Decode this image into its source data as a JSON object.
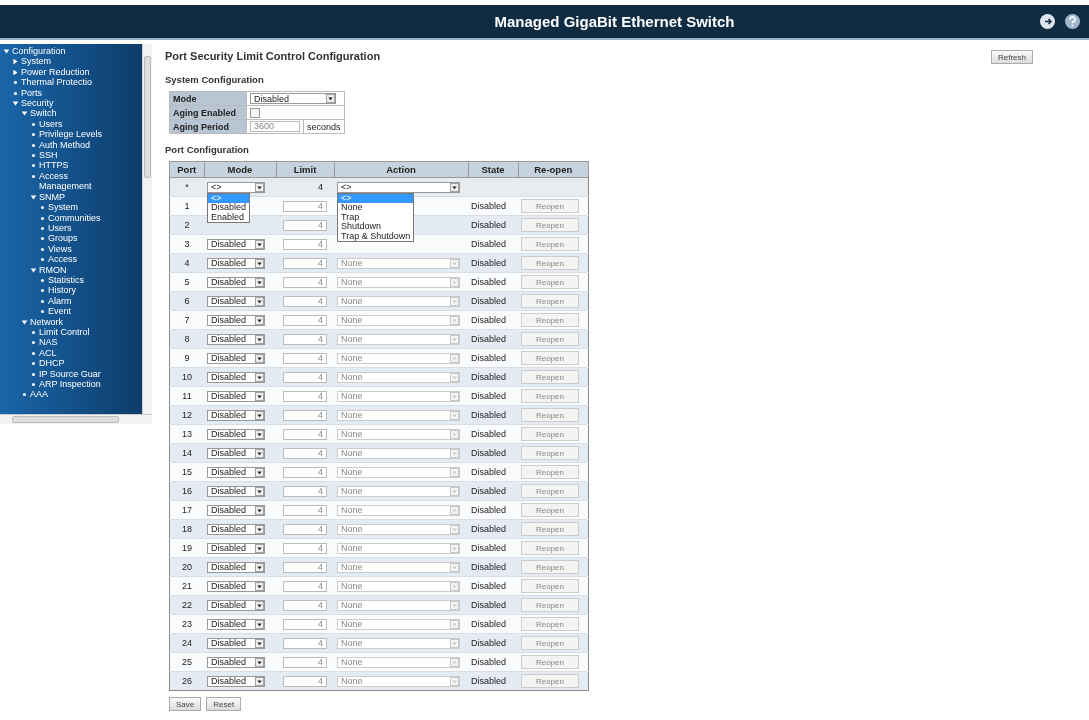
{
  "header": {
    "title": "Managed GigaBit Ethernet Switch"
  },
  "sidebar": {
    "items": [
      {
        "label": "Configuration",
        "expanded": true,
        "children": [
          {
            "label": "System",
            "expanded": false
          },
          {
            "label": "Power Reduction",
            "expanded": false
          },
          {
            "label": "Thermal Protectio"
          },
          {
            "label": "Ports"
          },
          {
            "label": "Security",
            "expanded": true,
            "children": [
              {
                "label": "Switch",
                "expanded": true,
                "children": [
                  {
                    "label": "Users"
                  },
                  {
                    "label": "Privilege Levels"
                  },
                  {
                    "label": "Auth Method"
                  },
                  {
                    "label": "SSH"
                  },
                  {
                    "label": "HTTPS"
                  },
                  {
                    "label": "Access Management"
                  },
                  {
                    "label": "SNMP",
                    "expanded": true,
                    "children": [
                      {
                        "label": "System"
                      },
                      {
                        "label": "Communities"
                      },
                      {
                        "label": "Users"
                      },
                      {
                        "label": "Groups"
                      },
                      {
                        "label": "Views"
                      },
                      {
                        "label": "Access"
                      }
                    ]
                  },
                  {
                    "label": "RMON",
                    "expanded": true,
                    "children": [
                      {
                        "label": "Statistics"
                      },
                      {
                        "label": "History"
                      },
                      {
                        "label": "Alarm"
                      },
                      {
                        "label": "Event"
                      }
                    ]
                  }
                ]
              },
              {
                "label": "Network",
                "expanded": true,
                "children": [
                  {
                    "label": "Limit Control"
                  },
                  {
                    "label": "NAS"
                  },
                  {
                    "label": "ACL"
                  },
                  {
                    "label": "DHCP"
                  },
                  {
                    "label": "IP Source Guar"
                  },
                  {
                    "label": "ARP Inspection"
                  }
                ]
              },
              {
                "label": "AAA"
              }
            ]
          }
        ]
      }
    ]
  },
  "page": {
    "title": "Port Security Limit Control Configuration",
    "refresh_button": "Refresh",
    "system_config": {
      "heading": "System Configuration",
      "mode": {
        "label": "Mode",
        "value": "Disabled"
      },
      "aging_enabled": {
        "label": "Aging Enabled",
        "checked": false
      },
      "aging_period": {
        "label": "Aging Period",
        "value": "3600",
        "unit": "seconds"
      }
    },
    "port_config": {
      "heading": "Port Configuration",
      "columns": [
        "Port",
        "Mode",
        "Limit",
        "Action",
        "State",
        "Re-open"
      ],
      "all_row": {
        "port": "*",
        "mode": "<>",
        "limit": "4",
        "action": "<>"
      },
      "mode_dropdown": {
        "options": [
          {
            "label": "<>",
            "selected": true
          },
          {
            "label": "Disabled",
            "selected": false
          },
          {
            "label": "Enabled",
            "selected": false
          }
        ]
      },
      "action_dropdown": {
        "options": [
          {
            "label": "<>",
            "selected": true
          },
          {
            "label": "None",
            "selected": false
          },
          {
            "label": "Trap",
            "selected": false
          },
          {
            "label": "Shutdown",
            "selected": false
          },
          {
            "label": "Trap & Shutdown",
            "selected": false
          }
        ]
      },
      "rows": [
        {
          "port": "1",
          "limit": "4",
          "state": "Disabled",
          "reopen": "Reopen"
        },
        {
          "port": "2",
          "limit": "4",
          "state": "Disabled",
          "reopen": "Reopen"
        },
        {
          "port": "3",
          "mode": "Disabled",
          "limit": "4",
          "state": "Disabled",
          "reopen": "Reopen"
        },
        {
          "port": "4",
          "mode": "Disabled",
          "limit": "4",
          "action": "None",
          "state": "Disabled",
          "reopen": "Reopen"
        },
        {
          "port": "5",
          "mode": "Disabled",
          "limit": "4",
          "action": "None",
          "state": "Disabled",
          "reopen": "Reopen"
        },
        {
          "port": "6",
          "mode": "Disabled",
          "limit": "4",
          "action": "None",
          "state": "Disabled",
          "reopen": "Reopen"
        },
        {
          "port": "7",
          "mode": "Disabled",
          "limit": "4",
          "action": "None",
          "state": "Disabled",
          "reopen": "Reopen"
        },
        {
          "port": "8",
          "mode": "Disabled",
          "limit": "4",
          "action": "None",
          "state": "Disabled",
          "reopen": "Reopen"
        },
        {
          "port": "9",
          "mode": "Disabled",
          "limit": "4",
          "action": "None",
          "state": "Disabled",
          "reopen": "Reopen"
        },
        {
          "port": "10",
          "mode": "Disabled",
          "limit": "4",
          "action": "None",
          "state": "Disabled",
          "reopen": "Reopen"
        },
        {
          "port": "11",
          "mode": "Disabled",
          "limit": "4",
          "action": "None",
          "state": "Disabled",
          "reopen": "Reopen"
        },
        {
          "port": "12",
          "mode": "Disabled",
          "limit": "4",
          "action": "None",
          "state": "Disabled",
          "reopen": "Reopen"
        },
        {
          "port": "13",
          "mode": "Disabled",
          "limit": "4",
          "action": "None",
          "state": "Disabled",
          "reopen": "Reopen"
        },
        {
          "port": "14",
          "mode": "Disabled",
          "limit": "4",
          "action": "None",
          "state": "Disabled",
          "reopen": "Reopen"
        },
        {
          "port": "15",
          "mode": "Disabled",
          "limit": "4",
          "action": "None",
          "state": "Disabled",
          "reopen": "Reopen"
        },
        {
          "port": "16",
          "mode": "Disabled",
          "limit": "4",
          "action": "None",
          "state": "Disabled",
          "reopen": "Reopen"
        },
        {
          "port": "17",
          "mode": "Disabled",
          "limit": "4",
          "action": "None",
          "state": "Disabled",
          "reopen": "Reopen"
        },
        {
          "port": "18",
          "mode": "Disabled",
          "limit": "4",
          "action": "None",
          "state": "Disabled",
          "reopen": "Reopen"
        },
        {
          "port": "19",
          "mode": "Disabled",
          "limit": "4",
          "action": "None",
          "state": "Disabled",
          "reopen": "Reopen"
        },
        {
          "port": "20",
          "mode": "Disabled",
          "limit": "4",
          "action": "None",
          "state": "Disabled",
          "reopen": "Reopen"
        },
        {
          "port": "21",
          "mode": "Disabled",
          "limit": "4",
          "action": "None",
          "state": "Disabled",
          "reopen": "Reopen"
        },
        {
          "port": "22",
          "mode": "Disabled",
          "limit": "4",
          "action": "None",
          "state": "Disabled",
          "reopen": "Reopen"
        },
        {
          "port": "23",
          "mode": "Disabled",
          "limit": "4",
          "action": "None",
          "state": "Disabled",
          "reopen": "Reopen"
        },
        {
          "port": "24",
          "mode": "Disabled",
          "limit": "4",
          "action": "None",
          "state": "Disabled",
          "reopen": "Reopen"
        },
        {
          "port": "25",
          "mode": "Disabled",
          "limit": "4",
          "action": "None",
          "state": "Disabled",
          "reopen": "Reopen"
        },
        {
          "port": "26",
          "mode": "Disabled",
          "limit": "4",
          "action": "None",
          "state": "Disabled",
          "reopen": "Reopen"
        }
      ]
    },
    "buttons": [
      "Save",
      "Reset"
    ]
  }
}
